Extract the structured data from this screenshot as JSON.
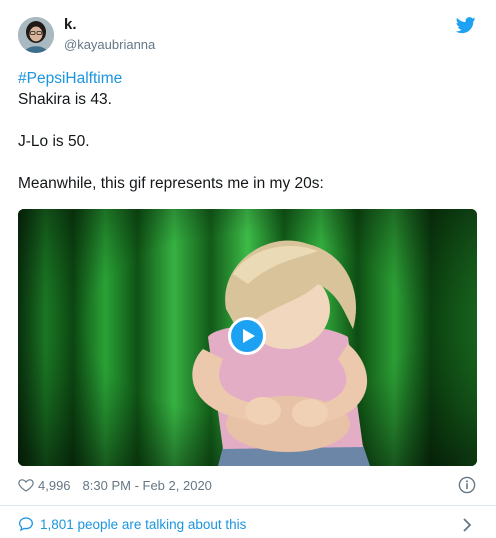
{
  "author": {
    "display_name": "k.",
    "handle": "@kayaubrianna"
  },
  "tweet": {
    "hashtag": "#PepsiHalftime",
    "lines": [
      "Shakira is 43.",
      "J-Lo is 50.",
      "Meanwhile, this gif represents me in my 20s:"
    ]
  },
  "media": {
    "type": "gif",
    "play_icon": "play-icon"
  },
  "footer": {
    "likes": "4,996",
    "timestamp": "8:30 PM - Feb 2, 2020",
    "conversation": "1,801 people are talking about this"
  },
  "icons": {
    "brand": "twitter-bird-icon",
    "like": "heart-icon",
    "info": "info-icon",
    "conversation": "speech-bubble-icon",
    "expand": "chevron-right-icon"
  },
  "colors": {
    "link": "#1b95e0",
    "brand": "#1da1f2",
    "muted": "#657786",
    "text": "#14171a"
  }
}
